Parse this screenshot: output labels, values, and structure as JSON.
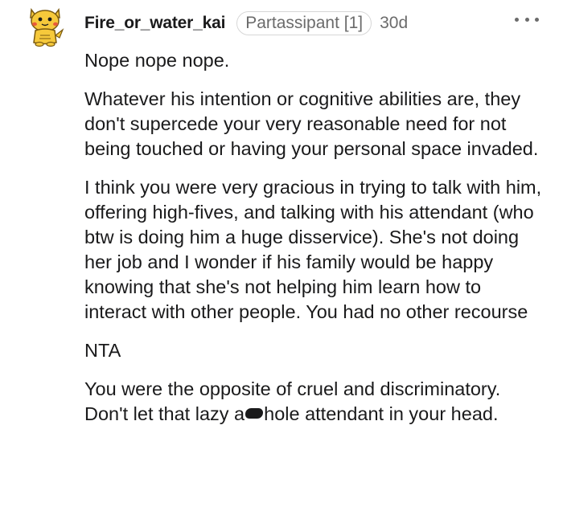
{
  "comment": {
    "username": "Fire_or_water_kai",
    "flair": "Partassipant [1]",
    "timestamp": "30d",
    "more_icon": "ellipsis-horizontal-icon",
    "avatar_icon": "snoo-avatar-icon",
    "paragraphs": {
      "p1": "Nope nope nope.",
      "p2": "Whatever his intention or cognitive abilities are, they don't supercede your very reasonable need for not being touched or having your personal space invaded.",
      "p3": "I think you were very gracious in trying to talk with him, offering high-fives, and talking with his attendant (who btw is doing him a huge disservice). She's not doing her job and I wonder if his family would be happy knowing that she's not helping him learn how to interact with other people. You had no other recourse",
      "p4": "NTA",
      "p5_start": "You were the opposite of cruel and discriminatory. Don't let that lazy a",
      "p5_end": "hole attendant in your head."
    }
  },
  "colors": {
    "text": "#1a1a1b",
    "meta": "#6b6b6b",
    "avatar_yellow": "#f6c93b"
  }
}
